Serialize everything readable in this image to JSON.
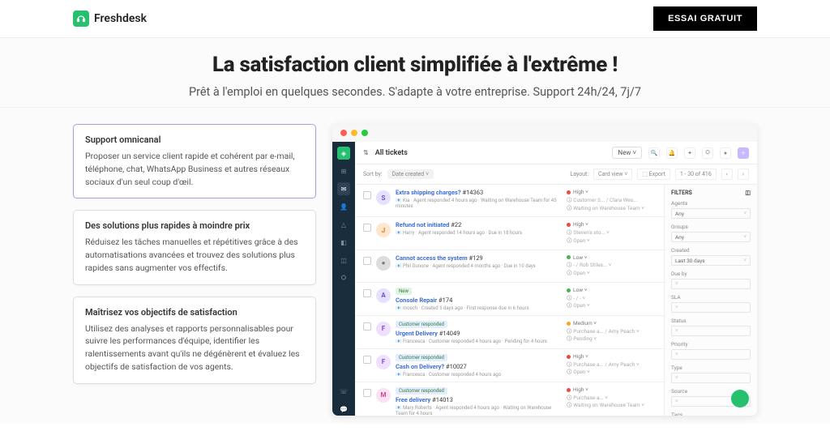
{
  "brand": "Freshdesk",
  "cta": "ESSAI GRATUIT",
  "hero": {
    "title": "La satisfaction client simplifiée à l'extrême !",
    "subtitle": "Prêt à l'emploi en quelques secondes. S'adapte à votre entreprise. Support 24h/24, 7j/7"
  },
  "cards": [
    {
      "title": "Support omnicanal",
      "text": "Proposer un service client rapide et cohérent par e-mail, téléphone, chat, WhatsApp Business et autres réseaux sociaux d'un seul coup d'œil.",
      "active": true
    },
    {
      "title": "Des solutions plus rapides à moindre prix",
      "text": "Réduisez les tâches manuelles et répétitives grâce à des automatisations avancées et trouvez des solutions plus rapides sans augmenter vos effectifs.",
      "active": false
    },
    {
      "title": "Maîtrisez vos objectifs de satisfaction",
      "text": "Utilisez des analyses et rapports personnalisables pour suivre les performances d'équipe, identifier les ralentissements avant qu'ils ne dégénèrent et évaluez les objectifs de satisfaction de vos agents.",
      "active": false
    }
  ],
  "mock": {
    "header_title": "All tickets",
    "new_btn": "New ˅",
    "sort": {
      "label": "Sort by:",
      "value": "Date created ˅",
      "layout": "Layout:",
      "card": "Card view ˅",
      "range": "1 - 30 of 416"
    },
    "filter_icon": "⇅",
    "tickets": [
      {
        "av": "S",
        "avcol": "#e6e1ff",
        "avt": "#6b4ed8",
        "tag": "",
        "tagcol": "",
        "subject": "Extra shipping charges?",
        "id": "#14363",
        "meta": "Kia · Agent responded 4 hours ago · Waiting on Warehouse Team for 45 minutes",
        "pri": "High",
        "pricls": "high",
        "cust": "Customer S... / Clara Wes...",
        "status": "Waiting on Warehouse Team ˅"
      },
      {
        "av": "J",
        "avcol": "#ffe6cc",
        "avt": "#d97a1a",
        "tag": "",
        "tagcol": "",
        "subject": "Refund not initiated",
        "id": "#22",
        "meta": "Harry · Agent responded 14 hours ago · Due in 18 hours",
        "pri": "High",
        "pricls": "high",
        "cust": "Steven's sto... ˅",
        "status": "Open ˅"
      },
      {
        "av": "●",
        "avcol": "#ddd",
        "avt": "#777",
        "tag": "",
        "tagcol": "",
        "subject": "Cannot access the system",
        "id": "#129",
        "meta": "Phil Dunone · Agent responded 4 months ago · Due in 10 days",
        "pri": "Low",
        "pricls": "low",
        "cust": "- / Rob Stiles... ˅",
        "status": "Open ˅"
      },
      {
        "av": "A",
        "avcol": "#e6e1ff",
        "avt": "#6b4ed8",
        "tag": "New",
        "tagcol": "#dff5e4",
        "subject": "Console Repair",
        "id": "#174",
        "meta": "mosch · Created 5 days ago · First response due in 6 hours",
        "pri": "Low",
        "pricls": "low",
        "cust": "- / - ˅",
        "status": "Open ˅"
      },
      {
        "av": "F",
        "avcol": "#efe0ff",
        "avt": "#7b4ed8",
        "tag": "Customer responded",
        "tagcol": "#e2edff",
        "subject": "Urgent Delivery",
        "id": "#14049",
        "meta": "Francesca · Customer responded 4 hours ago · Pending for 4 hours",
        "pri": "Medium",
        "pricls": "med",
        "cust": "Purchase a... / Amy Peach ˅",
        "status": "Pending ˅"
      },
      {
        "av": "F",
        "avcol": "#efe0ff",
        "avt": "#7b4ed8",
        "tag": "Customer responded",
        "tagcol": "#e2edff",
        "subject": "Cash on Delivery?",
        "id": "#10027",
        "meta": "Francesca · Customer responded 4 hours ago",
        "pri": "High",
        "pricls": "high",
        "cust": "Purchase a... / Amy Peach ˅",
        "status": "Open ˅"
      },
      {
        "av": "M",
        "avcol": "#ffe0f0",
        "avt": "#c44d9a",
        "tag": "Customer responded",
        "tagcol": "#e2edff",
        "subject": "Free delivery",
        "id": "#14013",
        "meta": "Mary Roberts · Agent responded 4 hours ago · Waiting on Warehouse Team for 4 hours",
        "pri": "High",
        "pricls": "high",
        "cust": "Purchase a... ˅",
        "status": "Waiting on Warehouse Team ˅"
      }
    ],
    "filters": {
      "title": "FILTERS",
      "groups": [
        {
          "label": "Agents",
          "value": "Any"
        },
        {
          "label": "Groups",
          "value": "Any"
        },
        {
          "label": "Created",
          "value": "Last 30 days"
        },
        {
          "label": "Due by",
          "value": ""
        },
        {
          "label": "SLA",
          "value": ""
        },
        {
          "label": "Status",
          "value": ""
        },
        {
          "label": "Priority",
          "value": ""
        },
        {
          "label": "Type",
          "value": ""
        },
        {
          "label": "Source",
          "value": ""
        },
        {
          "label": "Tags",
          "value": ""
        }
      ]
    }
  }
}
